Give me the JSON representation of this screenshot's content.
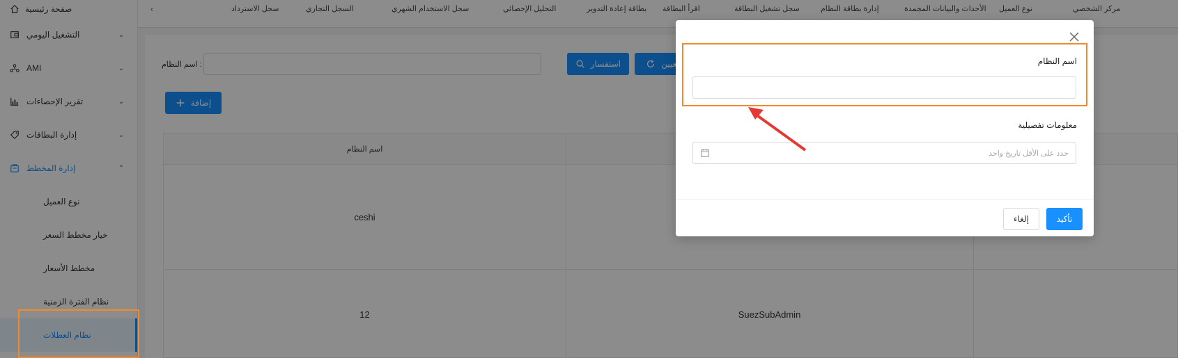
{
  "sidebar": {
    "home_label": "صفحة رئيسية",
    "items": [
      {
        "label": "التشغيل اليومي",
        "icon": "wallet-icon"
      },
      {
        "label": "AMI",
        "icon": "network-icon"
      },
      {
        "label": "تقرير الإحصاءات",
        "icon": "chart-icon"
      },
      {
        "label": "إدارة البطاقات",
        "icon": "tag-icon"
      },
      {
        "label": "إدارة المخطط",
        "icon": "box-icon"
      }
    ],
    "sub_items": [
      {
        "label": "نوع العميل"
      },
      {
        "label": "خيار مخطط السعر"
      },
      {
        "label": "مخطط الأسعار"
      },
      {
        "label": "نظام الفترة الزمنية"
      },
      {
        "label": "نظام العطلات"
      }
    ]
  },
  "tabbar": {
    "tabs": [
      "مركز الشخصي",
      "نوع العميل",
      "الأحداث والبيانات المجمدة",
      "إدارة بطاقة النظام",
      "سجل تشغيل البطاقة",
      "اقرأ البطاقة",
      "بطاقة إعادة التدوير",
      "التحليل الإحصائي",
      "سجل الاستخدام الشهري",
      "السجل التجاري",
      "سجل الاسترداد"
    ],
    "scroll_left": "‹"
  },
  "content": {
    "search_label": "اسم النظام :",
    "query_button": "استفسار",
    "reset_button": "تعيين",
    "add_button": "إضافة",
    "table": {
      "headers": [
        "اسم النظام"
      ],
      "rows": [
        [
          "ceshi",
          ""
        ],
        [
          "12",
          "SuezSubAdmin"
        ]
      ]
    }
  },
  "modal": {
    "field1_label": "اسم النظام",
    "field1_value": "",
    "field2_label": "معلومات تفصيلية",
    "date_placeholder": "حدد على الأقل تاريخ واحد",
    "cancel_label": "إلغاء",
    "ok_label": "تأكيد"
  },
  "colors": {
    "primary": "#1890ff",
    "highlight": "#f08a2c",
    "arrow": "#e53935"
  }
}
